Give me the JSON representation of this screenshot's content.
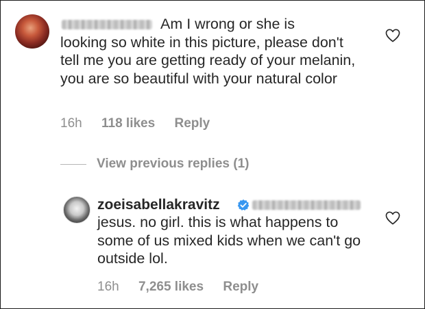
{
  "comment1": {
    "username": "",
    "text_line1": "Am I wrong or she is",
    "text_rest": "looking so white in this picture, please don't tell me you are getting ready of your melanin, you are so beautiful with your natural color",
    "time": "16h",
    "likes": "118 likes",
    "reply": "Reply"
  },
  "view_previous": "View previous replies (1)",
  "comment2": {
    "username": "zoeisabellakravitz",
    "text": "jesus. no girl. this is what happens to some of us mixed kids when we can't go outside lol.",
    "time": "16h",
    "likes": "7,265 likes",
    "reply": "Reply"
  },
  "icons": {
    "heart": "heart-outline-icon",
    "verified": "verified-badge-icon"
  },
  "colors": {
    "text": "#262626",
    "meta": "#8e8e8e",
    "verified": "#3897f0"
  }
}
